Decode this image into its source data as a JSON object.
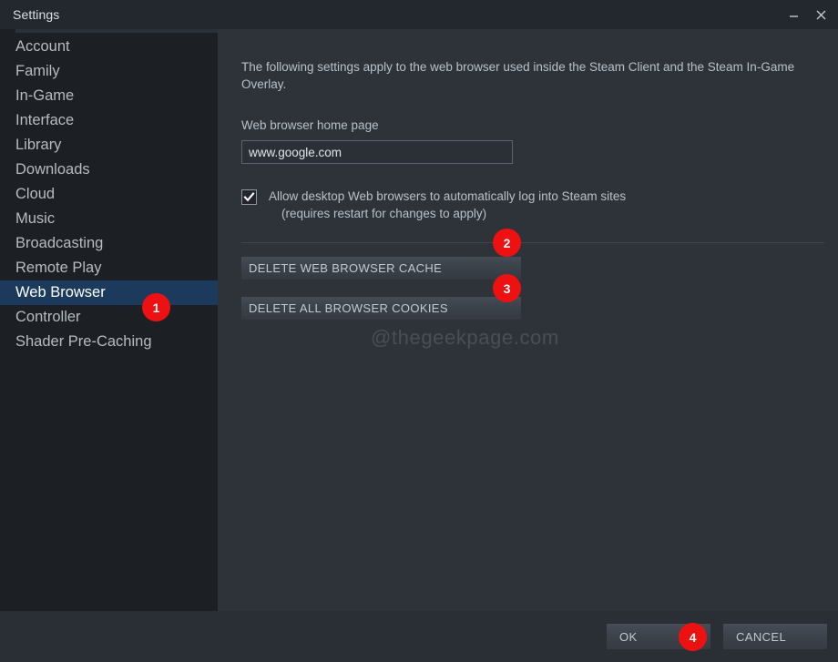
{
  "window": {
    "title": "Settings",
    "minimize_icon": "minimize-icon",
    "close_icon": "close-icon"
  },
  "sidebar": {
    "items": [
      {
        "label": "Account",
        "selected": false
      },
      {
        "label": "Family",
        "selected": false
      },
      {
        "label": "In-Game",
        "selected": false
      },
      {
        "label": "Interface",
        "selected": false
      },
      {
        "label": "Library",
        "selected": false
      },
      {
        "label": "Downloads",
        "selected": false
      },
      {
        "label": "Cloud",
        "selected": false
      },
      {
        "label": "Music",
        "selected": false
      },
      {
        "label": "Broadcasting",
        "selected": false
      },
      {
        "label": "Remote Play",
        "selected": false
      },
      {
        "label": "Web Browser",
        "selected": true
      },
      {
        "label": "Controller",
        "selected": false
      },
      {
        "label": "Shader Pre-Caching",
        "selected": false
      }
    ]
  },
  "main": {
    "intro": "The following settings apply to the web browser used inside the Steam Client and the Steam In-Game Overlay.",
    "home_page_label": "Web browser home page",
    "home_page_value": "www.google.com",
    "home_page_placeholder": "www.google.com",
    "checkbox": {
      "checked": true,
      "line1": "Allow desktop Web browsers to automatically log into Steam sites",
      "line2": "(requires restart for changes to apply)"
    },
    "delete_cache_label": "DELETE WEB BROWSER CACHE",
    "delete_cookies_label": "DELETE ALL BROWSER COOKIES",
    "watermark": "@thegeekpage.com"
  },
  "footer": {
    "ok_label": "OK",
    "cancel_label": "CANCEL"
  },
  "badges": {
    "one": "1",
    "two": "2",
    "three": "3",
    "four": "4",
    "color": "#ee1111"
  },
  "colors": {
    "window_bg": "#2a2e35",
    "titlebar_bg": "#23272e",
    "sidebar_bg": "#1c1f23",
    "content_bg": "#2e333a",
    "selection_bg": "#1b3a5c",
    "text_primary": "#c7d5e0",
    "badge_red": "#ee1111"
  }
}
